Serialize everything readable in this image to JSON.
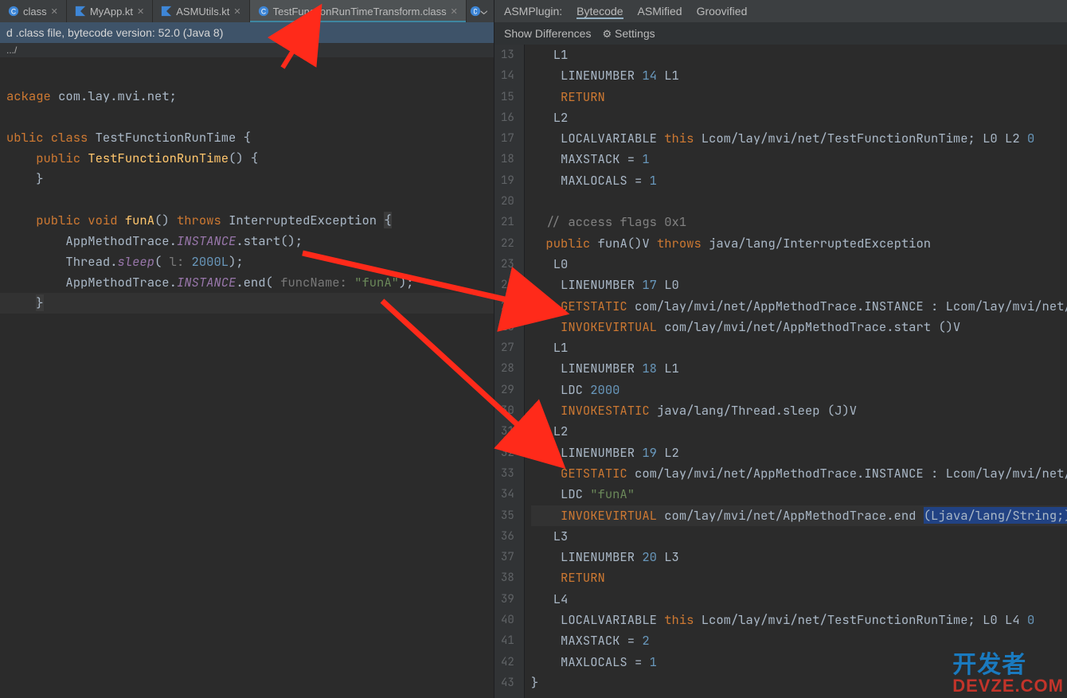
{
  "tabs": [
    {
      "label": "class",
      "icon": "class"
    },
    {
      "label": "MyApp.kt",
      "icon": "kt"
    },
    {
      "label": "ASMUtils.kt",
      "icon": "kt"
    },
    {
      "label": "TestFunctionRunTimeTransform.class",
      "icon": "class",
      "active": true
    }
  ],
  "info_bar": "d .class file, bytecode version: 52.0 (Java 8)",
  "breadcrumb": ".../",
  "left_code": [
    {
      "html": ""
    },
    {
      "html": "<span class='kw'>ackage</span> <span class='plain'>com.lay.mvi.net;</span>"
    },
    {
      "html": ""
    },
    {
      "html": "<span class='kw'>ublic class</span> <span class='plain'>TestFunctionRunTime {</span>"
    },
    {
      "html": "    <span class='kw'>public</span> <span class='id'>TestFunctionRunTime</span><span class='plain'>() {</span>"
    },
    {
      "html": "    <span class='plain'>}</span>"
    },
    {
      "html": ""
    },
    {
      "html": "    <span class='kw'>public void</span> <span class='id'>funA</span><span class='plain'>()</span> <span class='kw'>throws</span> <span class='plain'>InterruptedException </span><span class='plain' style='background:#3b3b3b'>{</span>"
    },
    {
      "html": "        <span class='plain'>AppMethodTrace.</span><span class='it'>INSTANCE</span><span class='plain'>.start();</span>"
    },
    {
      "html": "        <span class='plain'>Thread.</span><span class='it'>sleep</span><span class='plain'>( </span><span class='hint'>l: </span><span class='num'>2000L</span><span class='plain'>);</span>"
    },
    {
      "html": "        <span class='plain'>AppMethodTrace.</span><span class='it'>INSTANCE</span><span class='plain'>.end( </span><span class='hint'>funcName: </span><span class='str'>\"funA\"</span><span class='plain'>);</span>"
    },
    {
      "html": "    <span class='plain' style='background:#3b3b3b'>}</span>",
      "hl": true
    }
  ],
  "plugin_bar": {
    "label": "ASMPlugin:",
    "tabs": [
      "Bytecode",
      "ASMified",
      "Groovified"
    ],
    "active": 0
  },
  "toolbar2": {
    "diff": "Show Differences",
    "settings": "Settings"
  },
  "gutter_start": 13,
  "gutter_end": 43,
  "bc_lines": [
    {
      "n": 13,
      "html": "   <span class='plain'>L1</span>"
    },
    {
      "n": 14,
      "html": "    <span class='plain'>LINENUMBER </span><span class='num'>14</span><span class='plain'> L1</span>"
    },
    {
      "n": 15,
      "html": "    <span class='kw'>RETURN</span>"
    },
    {
      "n": 16,
      "html": "   <span class='plain'>L2</span>"
    },
    {
      "n": 17,
      "html": "    <span class='plain'>LOCALVARIABLE </span><span class='kw'>this</span> <span class='plain'>Lcom/lay/mvi/net/TestFunctionRunTime; L0 L2 </span><span class='num'>0</span>"
    },
    {
      "n": 18,
      "html": "    <span class='plain'>MAXSTACK = </span><span class='num'>1</span>"
    },
    {
      "n": 19,
      "html": "    <span class='plain'>MAXLOCALS = </span><span class='num'>1</span>"
    },
    {
      "n": 20,
      "html": ""
    },
    {
      "n": 21,
      "html": "  <span class='comment'>// access flags 0x1</span>"
    },
    {
      "n": 22,
      "html": "  <span class='kw'>public</span> <span class='plain'>funA()V </span><span class='kw'>throws</span> <span class='plain'>java/lang/InterruptedException</span>"
    },
    {
      "n": 23,
      "html": "   <span class='plain'>L0</span>"
    },
    {
      "n": 24,
      "html": "    <span class='plain'>LINENUMBER </span><span class='num'>17</span><span class='plain'> L0</span>"
    },
    {
      "n": 25,
      "html": "    <span class='kw'>GETSTATIC</span> <span class='plain'>com/lay/mvi/net/AppMethodTrace.INSTANCE : Lcom/lay/mvi/net/</span>"
    },
    {
      "n": 26,
      "html": "    <span class='kw'>INVOKEVIRTUAL</span> <span class='plain'>com/lay/mvi/net/AppMethodTrace.start ()V</span>"
    },
    {
      "n": 27,
      "html": "   <span class='plain'>L1</span>"
    },
    {
      "n": 28,
      "html": "    <span class='plain'>LINENUMBER </span><span class='num'>18</span><span class='plain'> L1</span>"
    },
    {
      "n": 29,
      "html": "    <span class='plain'>LDC </span><span class='num'>2000</span>"
    },
    {
      "n": 30,
      "html": "    <span class='kw'>INVOKESTATIC</span> <span class='plain'>java/lang/Thread.sleep (J)V</span>"
    },
    {
      "n": 31,
      "html": "   <span class='plain'>L2</span>"
    },
    {
      "n": 32,
      "html": "    <span class='plain'>LINENUMBER </span><span class='num'>19</span><span class='plain'> L2</span>"
    },
    {
      "n": 33,
      "html": "    <span class='kw'>GETSTATIC</span> <span class='plain'>com/lay/mvi/net/AppMethodTrace.INSTANCE : Lcom/lay/mvi/net/</span>"
    },
    {
      "n": 34,
      "html": "    <span class='plain'>LDC </span><span class='str'>\"funA\"</span>"
    },
    {
      "n": 35,
      "html": "    <span class='kw'>INVOKEVIRTUAL</span> <span class='plain'>com/lay/mvi/net/AppMethodTrace.end </span><span class='sel'>(Ljava/lang/String;)</span>",
      "cur": true
    },
    {
      "n": 36,
      "html": "   <span class='plain'>L3</span>"
    },
    {
      "n": 37,
      "html": "    <span class='plain'>LINENUMBER </span><span class='num'>20</span><span class='plain'> L3</span>"
    },
    {
      "n": 38,
      "html": "    <span class='kw'>RETURN</span>"
    },
    {
      "n": 39,
      "html": "   <span class='plain'>L4</span>"
    },
    {
      "n": 40,
      "html": "    <span class='plain'>LOCALVARIABLE </span><span class='kw'>this</span> <span class='plain'>Lcom/lay/mvi/net/TestFunctionRunTime; L0 L4 </span><span class='num'>0</span>"
    },
    {
      "n": 41,
      "html": "    <span class='plain'>MAXSTACK = </span><span class='num'>2</span>"
    },
    {
      "n": 42,
      "html": "    <span class='plain'>MAXLOCALS = </span><span class='num'>1</span>"
    },
    {
      "n": 43,
      "html": "<span class='plain'>}</span>"
    }
  ],
  "watermark": {
    "line1": "开发者",
    "line2": "DEVZE.COM"
  }
}
